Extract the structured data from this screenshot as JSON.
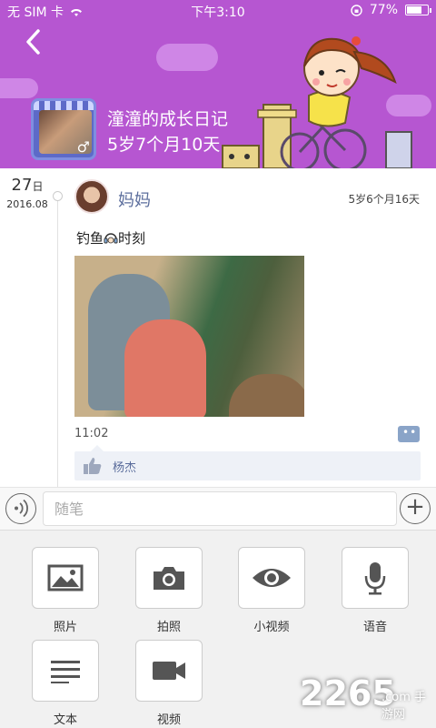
{
  "status_bar": {
    "carrier": "无 SIM 卡",
    "time": "下午3:10",
    "battery_percent": "77%",
    "battery_level": 0.77
  },
  "header": {
    "diary_title": "潼潼的成长日记",
    "child_age": "5岁7个月10天",
    "gender_symbol": "♂",
    "background_color": "#b656d1"
  },
  "post": {
    "date_day": "27",
    "date_day_unit": "日",
    "date_year_month": "2016.08",
    "author": "妈妈",
    "age_at_post": "5岁6个月16天",
    "text_before": "钓鱼",
    "emoji_icon": "headphones-emoji-icon",
    "text_after": "时刻",
    "time": "11:02",
    "liker": "杨杰"
  },
  "input": {
    "placeholder": "随笔"
  },
  "media_options": [
    {
      "label": "照片",
      "icon": "photo-icon"
    },
    {
      "label": "拍照",
      "icon": "camera-icon"
    },
    {
      "label": "小视频",
      "icon": "eye-video-icon"
    },
    {
      "label": "语音",
      "icon": "microphone-icon"
    },
    {
      "label": "文本",
      "icon": "text-lines-icon"
    },
    {
      "label": "视频",
      "icon": "video-camera-icon"
    }
  ],
  "watermark": {
    "number": "2265",
    "suffix": ".com 手游网"
  }
}
